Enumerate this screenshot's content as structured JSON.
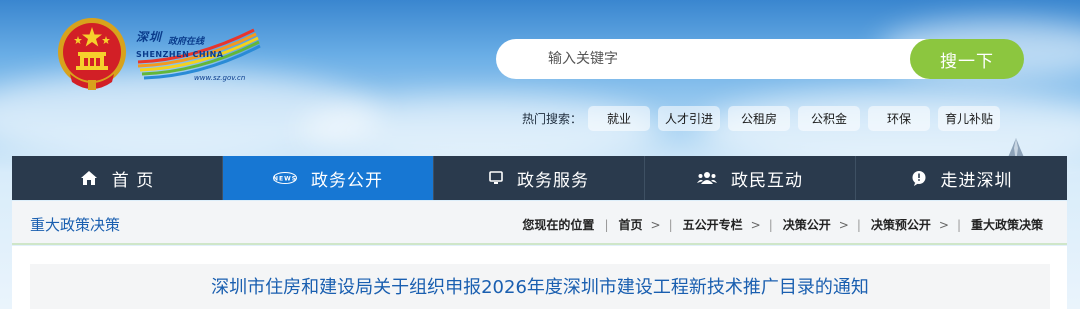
{
  "header": {
    "site_name_cn": "深圳",
    "site_subname_cn": "政府在线",
    "site_name_en": "SHENZHEN  CHINA",
    "site_url": "www.sz.gov.cn"
  },
  "search": {
    "placeholder": "输入关键字",
    "button_label": "搜一下"
  },
  "hot_search": {
    "label": "热门搜索：",
    "tags": [
      "就业",
      "人才引进",
      "公租房",
      "公积金",
      "环保",
      "育儿补贴"
    ]
  },
  "nav": {
    "items": [
      {
        "label": "首 页",
        "icon": "home-icon"
      },
      {
        "label": "政务公开",
        "icon": "news-icon"
      },
      {
        "label": "政务服务",
        "icon": "monitor-icon"
      },
      {
        "label": "政民互动",
        "icon": "people-icon"
      },
      {
        "label": "走进深圳",
        "icon": "chat-icon"
      }
    ],
    "active_index": 1,
    "colors": {
      "bar": "#2a3a4d",
      "active": "#1777d3"
    }
  },
  "breadcrumb": {
    "section_title": "重大政策决策",
    "prefix": "您现在的位置",
    "items": [
      "首页",
      "五公开专栏",
      "决策公开",
      "决策预公开",
      "重大政策决策"
    ]
  },
  "article": {
    "title": "深圳市住房和建设局关于组织申报2026年度深圳市建设工程新技术推广目录的通知"
  },
  "colors": {
    "accent": "#1a5fb0",
    "search_button": "#8cc63f"
  }
}
